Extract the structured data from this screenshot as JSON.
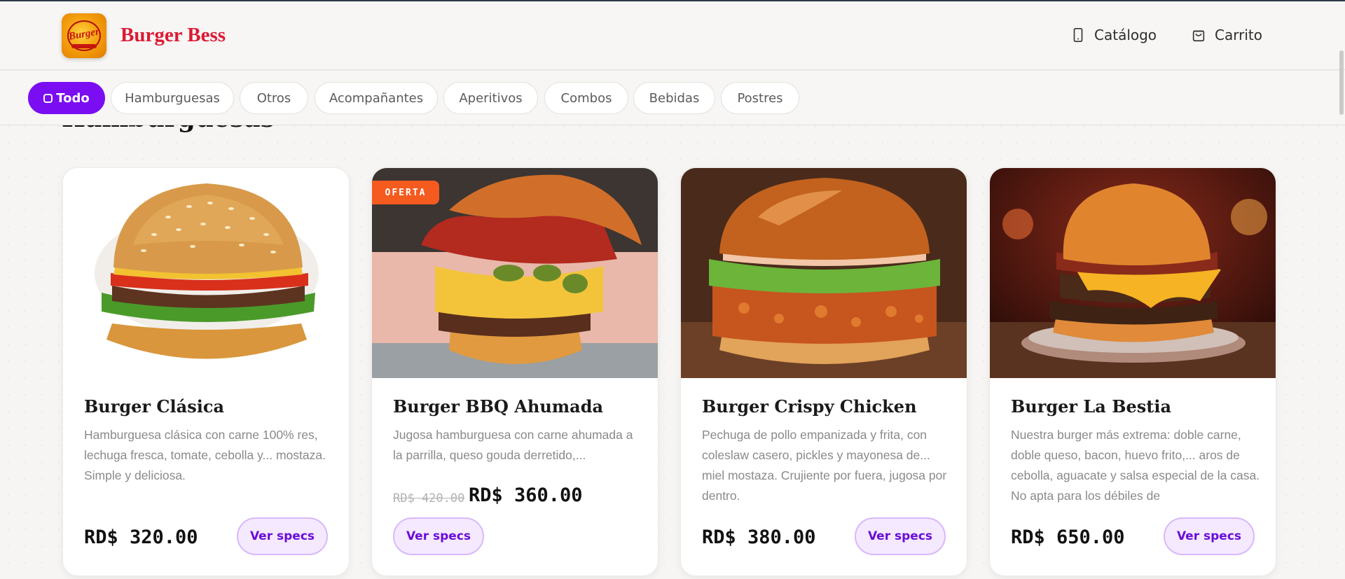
{
  "header": {
    "brand": "Burger Bess",
    "logo_text": "Burger",
    "nav": [
      {
        "label": "Catálogo",
        "icon": "phone-icon"
      },
      {
        "label": "Carrito",
        "icon": "shopping-bag-icon"
      }
    ]
  },
  "categories": [
    {
      "label": "Todo",
      "active": true
    },
    {
      "label": "Hamburguesas"
    },
    {
      "label": "Otros"
    },
    {
      "label": "Acompañantes"
    },
    {
      "label": "Aperitivos"
    },
    {
      "label": "Combos"
    },
    {
      "label": "Bebidas"
    },
    {
      "label": "Postres"
    }
  ],
  "section": {
    "title": "Hamburguesas"
  },
  "products": [
    {
      "name": "Burger Clásica",
      "description": "Hamburguesa clásica con carne 100% res, lechuga fresca, tomate, cebolla y... mostaza. Simple y deliciosa.",
      "price": "RD$ 320.00",
      "button": "Ver specs"
    },
    {
      "name": "Burger BBQ Ahumada",
      "badge": "OFERTA",
      "description": "Jugosa hamburguesa con carne ahumada a la parrilla, queso gouda derretido,...",
      "old_price": "RD$ 420.00",
      "price": "RD$ 360.00",
      "button": "Ver specs"
    },
    {
      "name": "Burger Crispy Chicken",
      "description": "Pechuga de pollo empanizada y frita, con coleslaw casero, pickles y mayonesa de... miel mostaza. Crujiente por fuera, jugosa por dentro.",
      "price": "RD$ 380.00",
      "button": "Ver specs"
    },
    {
      "name": "Burger La Bestia",
      "description": "Nuestra burger más extrema: doble carne, doble queso, bacon, huevo frito,... aros de cebolla, aguacate y salsa especial de la casa. No apta para los débiles de",
      "price": "RD$ 650.00",
      "button": "Ver specs"
    }
  ],
  "colors": {
    "brand": "#dd1a35",
    "accent": "#7a0df2",
    "badge": "#f55a1f"
  }
}
